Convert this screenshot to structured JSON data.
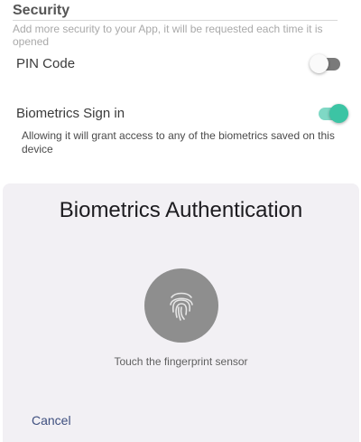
{
  "security": {
    "title": "Security",
    "description": "Add more security to your App, it will be requested each time it is opened",
    "pin_label": "PIN Code",
    "pin_enabled": false,
    "biometrics_label": "Biometrics Sign in",
    "biometrics_enabled": true,
    "biometrics_description": "Allowing it will grant access to any of the biometrics saved on this device"
  },
  "dialog": {
    "title": "Biometrics Authentication",
    "icon": "fingerprint-icon",
    "hint": "Touch the fingerprint sensor",
    "cancel_label": "Cancel"
  },
  "colors": {
    "toggle_on": "#3cc4a4",
    "toggle_off": "#7a7a7a",
    "sheet_background": "#f2f0f4",
    "fingerprint_circle": "#8e8e8e",
    "cancel_text": "#3e4f7f"
  }
}
